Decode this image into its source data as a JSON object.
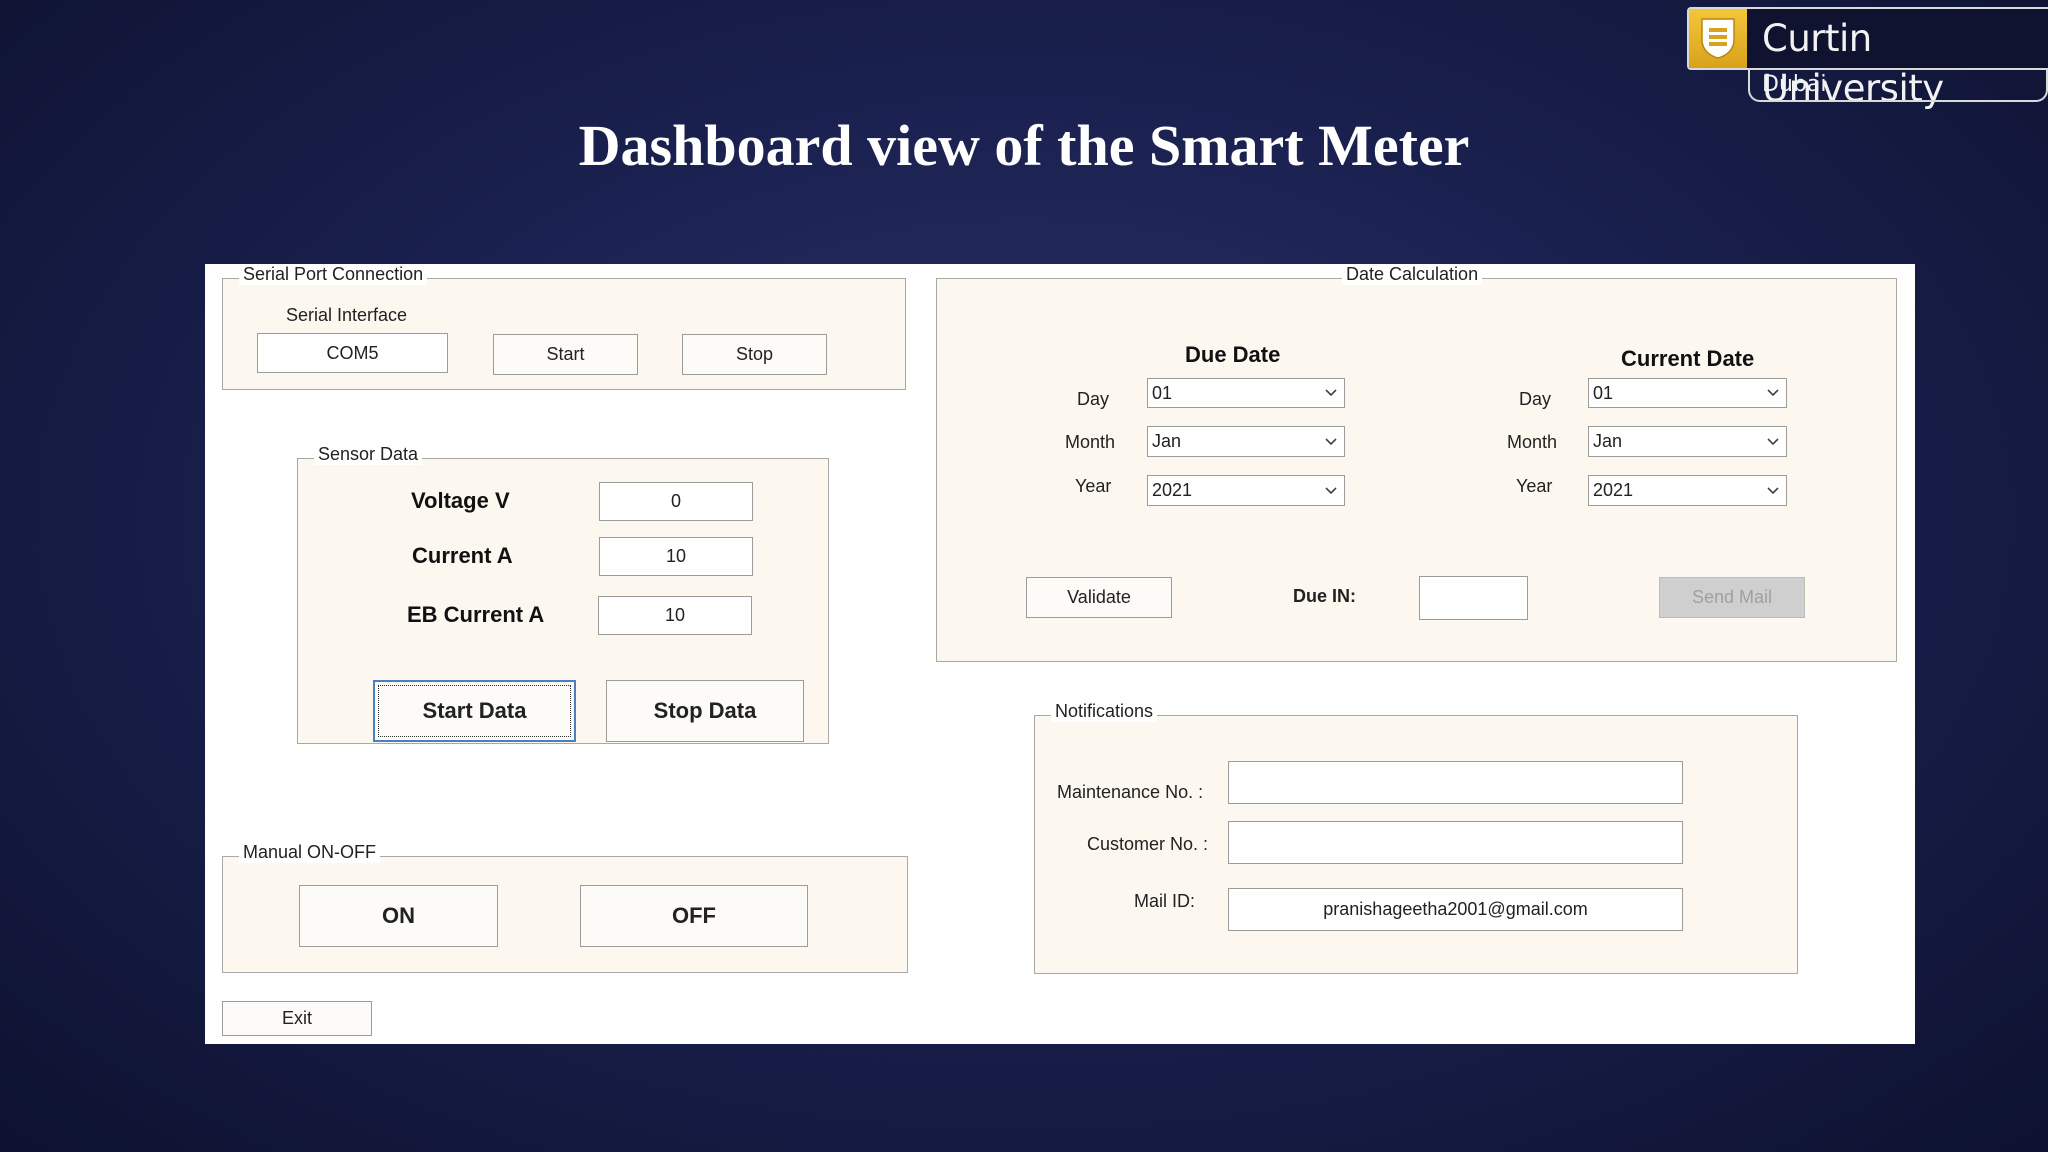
{
  "logo": {
    "name": "Curtin University",
    "campus": "Dubai",
    "accent": "#e7b52b"
  },
  "slide": {
    "title": "Dashboard view of the Smart Meter"
  },
  "serial_port": {
    "legend": "Serial Port Connection",
    "interface_label": "Serial Interface",
    "port_value": "COM5",
    "start_label": "Start",
    "stop_label": "Stop"
  },
  "sensor": {
    "legend": "Sensor Data",
    "voltage_label": "Voltage V",
    "voltage_value": "0",
    "current_label": "Current A",
    "current_value": "10",
    "eb_current_label": "EB Current A",
    "eb_current_value": "10",
    "start_data_label": "Start Data",
    "stop_data_label": "Stop Data"
  },
  "manual": {
    "legend": "Manual ON-OFF",
    "on_label": "ON",
    "off_label": "OFF"
  },
  "exit_label": "Exit",
  "date_calc": {
    "legend": "Date Calculation",
    "due_title": "Due Date",
    "current_title": "Current Date",
    "day_label": "Day",
    "month_label": "Month",
    "year_label": "Year",
    "due_day": "01",
    "due_month": "Jan",
    "due_year": "2021",
    "cur_day": "01",
    "cur_month": "Jan",
    "cur_year": "2021",
    "validate_label": "Validate",
    "due_in_label": "Due IN:",
    "due_in_value": "",
    "send_mail_label": "Send Mail"
  },
  "notifications": {
    "legend": "Notifications",
    "maintenance_label": "Maintenance No. :",
    "maintenance_value": "",
    "customer_label": "Customer No. :",
    "customer_value": "",
    "mail_label": "Mail ID:",
    "mail_value": "pranishageetha2001@gmail.com"
  }
}
